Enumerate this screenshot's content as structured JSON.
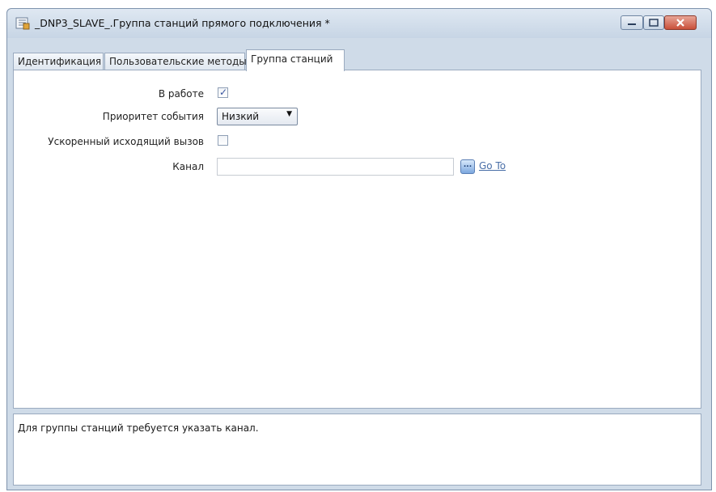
{
  "window": {
    "title": "_DNP3_SLAVE_.Группа станций прямого подключения *"
  },
  "tabs": [
    {
      "label": "Идентификация"
    },
    {
      "label": "Пользовательские методы"
    },
    {
      "label": "Группа станций",
      "active": true
    }
  ],
  "form": {
    "in_work": {
      "label": "В работе",
      "checked": true
    },
    "event_priority": {
      "label": "Приоритет события",
      "value": "Низкий"
    },
    "fast_outgoing_call": {
      "label": "Ускоренный исходящий вызов",
      "checked": false
    },
    "channel": {
      "label": "Канал",
      "value": "",
      "browse_label": "...",
      "goto_label": "Go To"
    }
  },
  "status_message": "Для группы станций требуется указать канал.",
  "icons": {
    "app": "document-list-icon",
    "minimize": "minimize-icon",
    "maximize": "maximize-icon",
    "close": "close-icon",
    "dropdown": "chevron-down-icon"
  },
  "colors": {
    "titlebar": "#cfdbe8",
    "close_button": "#c9503a",
    "link": "#4a6fa8",
    "checkmark": "#3a56a0"
  }
}
